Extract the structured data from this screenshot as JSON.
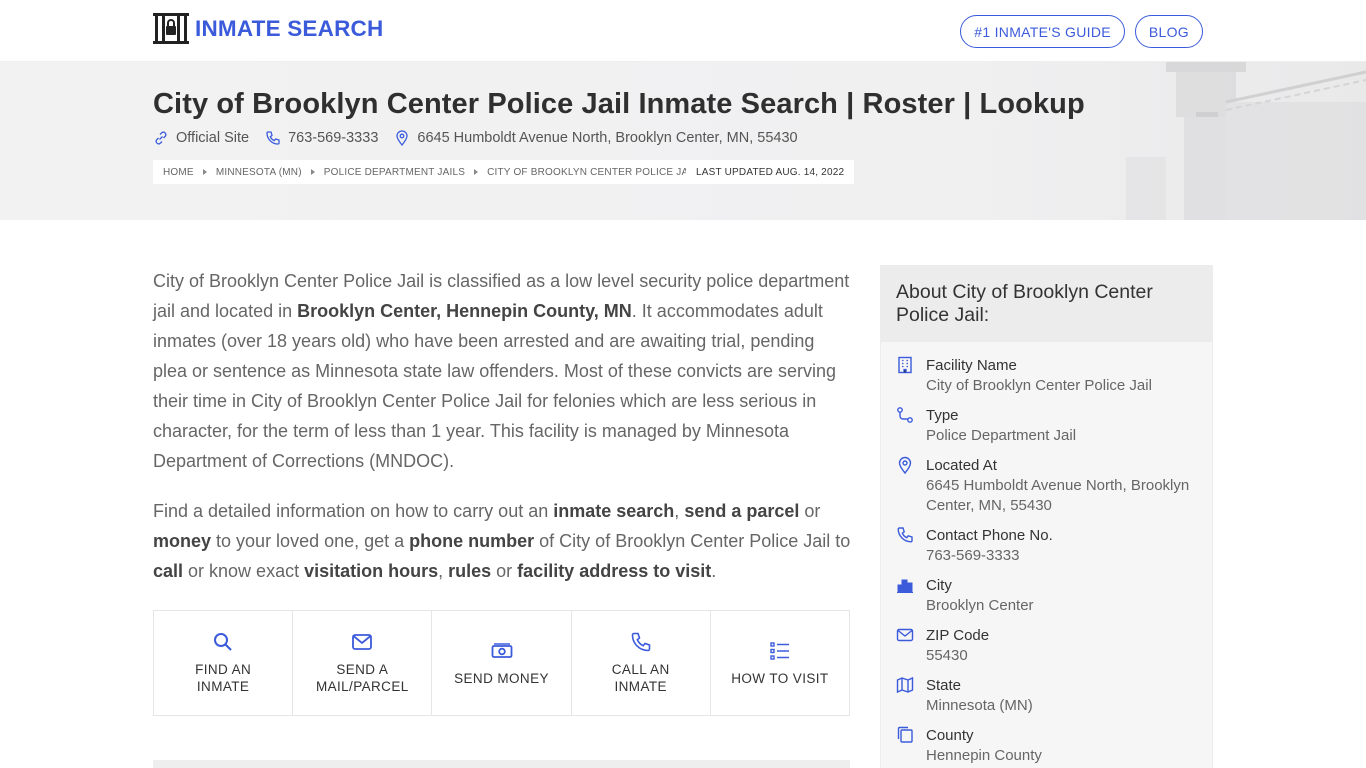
{
  "header": {
    "logo_text": "INMATE SEARCH",
    "nav": [
      {
        "label": "#1 INMATE'S GUIDE"
      },
      {
        "label": "BLOG"
      }
    ]
  },
  "hero": {
    "title": "City of Brooklyn Center Police Jail Inmate Search | Roster | Lookup",
    "official_site": "Official Site",
    "phone": "763-569-3333",
    "address": "6645 Humboldt Avenue North, Brooklyn Center, MN, 55430",
    "breadcrumbs": [
      "HOME",
      "MINNESOTA (MN)",
      "POLICE DEPARTMENT JAILS",
      "CITY OF BROOKLYN CENTER POLICE JAIL"
    ],
    "last_updated": "LAST UPDATED AUG. 14, 2022"
  },
  "intro": {
    "p1": {
      "a": "City of Brooklyn Center Police Jail is classified as a low level security police department jail and located in ",
      "b": "Brooklyn Center, Hennepin County, MN",
      "c": ". It accommodates adult inmates (over 18 years old) who have been arrested and are awaiting trial, pending plea or sentence as Minnesota state law offenders. Most of these convicts are serving their time in City of Brooklyn Center Police Jail for felonies which are less serious in character, for the term of less than 1 year. This facility is managed by Minnesota Department of Corrections (MNDOC)."
    },
    "p2": {
      "t1": "Find a detailed information on how to carry out an ",
      "b1": "inmate search",
      "t2": ", ",
      "b2": "send a parcel",
      "t3": " or ",
      "b3": "money",
      "t4": " to your loved one, get a ",
      "b4": "phone number",
      "t5": " of City of Brooklyn Center Police Jail to ",
      "b5": "call",
      "t6": " or know exact ",
      "b6": "visitation hours",
      "t7": ", ",
      "b7": "rules",
      "t8": " or ",
      "b8": "facility address to visit",
      "t9": "."
    }
  },
  "actions": [
    {
      "line1": "FIND AN",
      "line2": "INMATE",
      "icon": "search-icon"
    },
    {
      "line1": "SEND A",
      "line2": "MAIL/PARCEL",
      "icon": "mail-icon"
    },
    {
      "line1": "SEND MONEY",
      "line2": "",
      "icon": "money-icon"
    },
    {
      "line1": "CALL AN",
      "line2": "INMATE",
      "icon": "phone-icon"
    },
    {
      "line1": "HOW TO VISIT",
      "line2": "",
      "icon": "list-icon"
    }
  ],
  "sidebar": {
    "title": "About City of Brooklyn Center Police Jail:",
    "rows": [
      {
        "label": "Facility Name",
        "value": "City of Brooklyn Center Police Jail",
        "icon": "building-icon"
      },
      {
        "label": "Type",
        "value": "Police Department Jail",
        "icon": "route-icon"
      },
      {
        "label": "Located At",
        "value": "6645 Humboldt Avenue North, Brooklyn Center, MN, 55430",
        "icon": "location-pin-icon"
      },
      {
        "label": "Contact Phone No.",
        "value": "763-569-3333",
        "icon": "phone-icon"
      },
      {
        "label": "City",
        "value": "Brooklyn Center",
        "icon": "city-icon"
      },
      {
        "label": "ZIP Code",
        "value": "55430",
        "icon": "mail-icon"
      },
      {
        "label": "State",
        "value": "Minnesota (MN)",
        "icon": "map-icon"
      },
      {
        "label": "County",
        "value": "Hennepin County",
        "icon": "copy-icon"
      }
    ]
  },
  "colors": {
    "accent": "#3b5bdb",
    "hero_bg": "#f1f1f2",
    "text": "#666666"
  }
}
